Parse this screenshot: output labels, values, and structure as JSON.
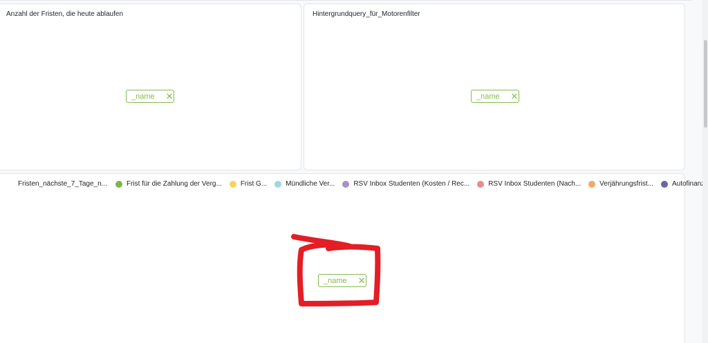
{
  "cards": {
    "top_left": {
      "title": "Anzahl der Fristen, die heute ablaufen",
      "filter_tag": {
        "label": "_name",
        "remove": "✕"
      }
    },
    "top_right": {
      "title": "Hintergrundquery_für_Motorenfilter",
      "filter_tag": {
        "label": "_name",
        "remove": "✕"
      }
    },
    "bottom": {
      "legend": {
        "series_title": "Fristen_nächste_7_Tage_n...",
        "items": [
          {
            "label": "Frist für die Zahlung der Verg...",
            "color": "#7cb74a"
          },
          {
            "label": "Frist G...",
            "color": "#f4d35e"
          },
          {
            "label": "Mündliche Ver...",
            "color": "#9fd9dd"
          },
          {
            "label": "RSV Inbox Studenten (Kosten / Rec...",
            "color": "#a98fcb"
          },
          {
            "label": "RSV Inbox Studenten (Nach...",
            "color": "#ea8a8a"
          },
          {
            "label": "Verjährungsfrist...",
            "color": "#f0a96b"
          },
          {
            "label": "Autofinanzierung ...",
            "color": "#6a66a8"
          }
        ]
      },
      "filter_tag": {
        "label": "_name",
        "remove": "✕"
      }
    }
  },
  "colors": {
    "tag_accent": "#84bb4c",
    "annotation_red": "#e31e24"
  }
}
